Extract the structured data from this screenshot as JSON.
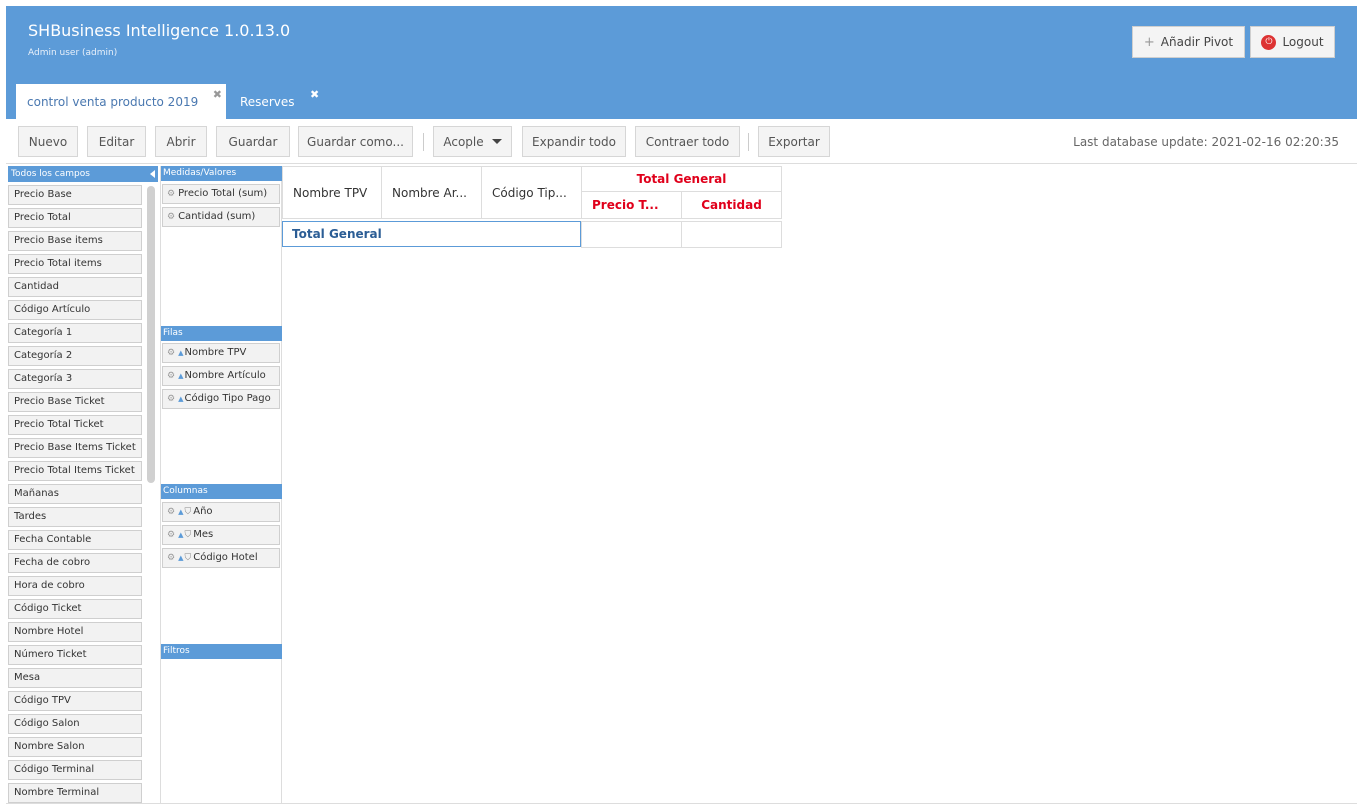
{
  "header": {
    "title": "SHBusiness Intelligence 1.0.13.0",
    "user": "Admin user (admin)",
    "add_pivot_label": "Añadir Pivot",
    "logout_label": "Logout"
  },
  "tabs": [
    {
      "label": "control venta producto 2019",
      "close": "✖"
    },
    {
      "label": "Reserves",
      "close": "✖"
    }
  ],
  "toolbar": {
    "nuevo": "Nuevo",
    "editar": "Editar",
    "abrir": "Abrir",
    "guardar": "Guardar",
    "guardar_como": "Guardar como...",
    "acople": "Acople",
    "expandir": "Expandir todo",
    "contraer": "Contraer todo",
    "exportar": "Exportar",
    "last_update": "Last database update: 2021-02-16 02:20:35"
  },
  "fields_panel": {
    "title": "Todos los campos",
    "items": [
      "Precio Base",
      "Precio Total",
      "Precio Base items",
      "Precio Total items",
      "Cantidad",
      "Código Artículo",
      "Categoría 1",
      "Categoría 2",
      "Categoría 3",
      "Precio Base Ticket",
      "Precio Total Ticket",
      "Precio Base Items Ticket",
      "Precio Total Items Ticket",
      "Mañanas",
      "Tardes",
      "Fecha Contable",
      "Fecha de cobro",
      "Hora de cobro",
      "Código Ticket",
      "Nombre Hotel",
      "Número Ticket",
      "Mesa",
      "Código TPV",
      "Código Salon",
      "Nombre Salon",
      "Código Terminal",
      "Nombre Terminal"
    ]
  },
  "zones": {
    "medidas": {
      "title": "Medidas/Valores",
      "items": [
        "Precio Total (sum)",
        "Cantidad (sum)"
      ]
    },
    "filas": {
      "title": "Filas",
      "items": [
        "Nombre TPV",
        "Nombre Artículo",
        "Código Tipo Pago"
      ]
    },
    "columnas": {
      "title": "Columnas",
      "items": [
        "Año",
        "Mes",
        "Código Hotel"
      ]
    },
    "filtros": {
      "title": "Filtros"
    }
  },
  "pivot": {
    "row_headers": [
      "Nombre TPV",
      "Nombre Ar...",
      "Código Tip..."
    ],
    "total_general": "Total General",
    "measures": [
      "Precio T...",
      "Cantidad"
    ],
    "total_row": "Total General"
  },
  "colors": {
    "header_blue": "#5c9bd8",
    "total_red": "#e0001b"
  }
}
